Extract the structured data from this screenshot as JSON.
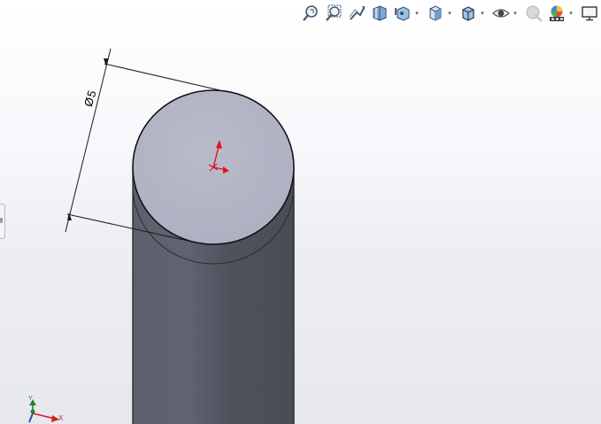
{
  "toolbar": {
    "buttons": [
      {
        "name": "zoom-to-fit",
        "icon": "zoom-fit-icon",
        "has_caret": false
      },
      {
        "name": "zoom-to-area",
        "icon": "zoom-area-icon",
        "has_caret": false
      },
      {
        "name": "previous-view",
        "icon": "previous-view-icon",
        "has_caret": false
      },
      {
        "name": "section-view",
        "icon": "section-view-icon",
        "has_caret": false
      },
      {
        "name": "dynamic-annotation-views",
        "icon": "annotation-view-icon",
        "has_caret": true
      },
      {
        "name": "view-orientation",
        "icon": "cube-orientation-icon",
        "has_caret": true
      },
      {
        "name": "display-style",
        "icon": "display-style-icon",
        "has_caret": true
      },
      {
        "name": "hide-show-items",
        "icon": "eye-icon",
        "has_caret": true
      },
      {
        "name": "edit-appearance",
        "icon": "appearance-sphere-icon",
        "has_caret": false
      },
      {
        "name": "apply-scene",
        "icon": "scene-icon",
        "has_caret": true
      },
      {
        "name": "view-settings",
        "icon": "monitor-icon",
        "has_caret": true
      }
    ],
    "caret_glyph": "▾"
  },
  "model": {
    "dimension_label": "Ø5",
    "face_color": "#b4b6c7",
    "body_color": "#565963",
    "origin_color": "#e0141a"
  },
  "triad": {
    "x_label": "X",
    "y_label": "Y",
    "x_color": "#d21e1e",
    "y_color": "#2d7d2d",
    "z_color": "#1f3fb0"
  }
}
